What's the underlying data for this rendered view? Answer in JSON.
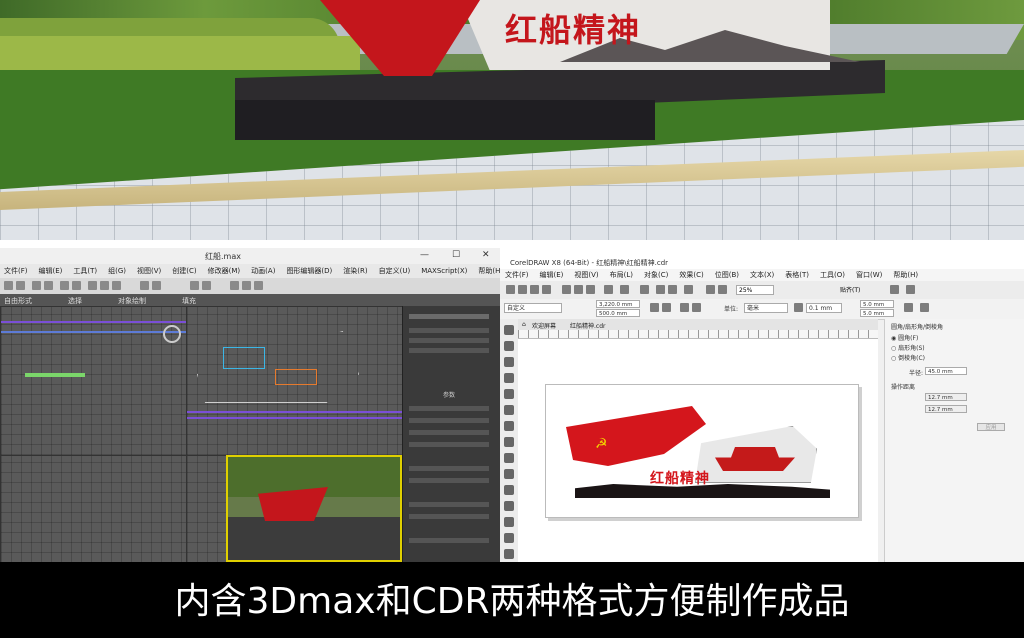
{
  "scene": {
    "sign_text": "红船精神"
  },
  "max_window": {
    "title": "红船.max",
    "menu": [
      "文件(F)",
      "编辑(E)",
      "工具(T)",
      "组(G)",
      "视图(V)",
      "创建(C)",
      "修改器(M)",
      "动画(A)",
      "图形编辑器(D)",
      "渲染(R)",
      "自定义(U)",
      "MAXScript(X)",
      "帮助(H)"
    ],
    "tabs": [
      "自由形式",
      "选择",
      "对象绘制",
      "填充"
    ],
    "side_section": "参数"
  },
  "cdr_window": {
    "title": "CorelDRAW X8 (64-Bit) - 红船精神\\红船精神.cdr",
    "menu": [
      "文件(F)",
      "编辑(E)",
      "视图(V)",
      "布局(L)",
      "对象(C)",
      "效果(C)",
      "位图(B)",
      "文本(X)",
      "表格(T)",
      "工具(O)",
      "窗口(W)",
      "帮助(H)"
    ],
    "zoom": "25%",
    "snap_label": "贴齐(T)",
    "preset": "自定义",
    "width": "3,220.0 mm",
    "height": "500.0 mm",
    "units_label": "单位:",
    "units": "毫米",
    "nudge": "0.1 mm",
    "dup_x": "5.0 mm",
    "dup_y": "5.0 mm",
    "doc_tabs": [
      "欢迎屏幕",
      "红船精神.cdr"
    ],
    "artwork_text": "红船精神",
    "panel": {
      "title": "圆角/扇形角/倒棱角",
      "options": [
        "圆角(F)",
        "扇形角(S)",
        "倒棱角(C)"
      ],
      "radius_label": "半径:",
      "radius": "45.0 mm",
      "distance_section": "操作距离",
      "dist1": "12.7 mm",
      "dist2": "12.7 mm",
      "apply": "应用"
    }
  },
  "caption": "内含3Dmax和CDR两种格式方便制作成品"
}
